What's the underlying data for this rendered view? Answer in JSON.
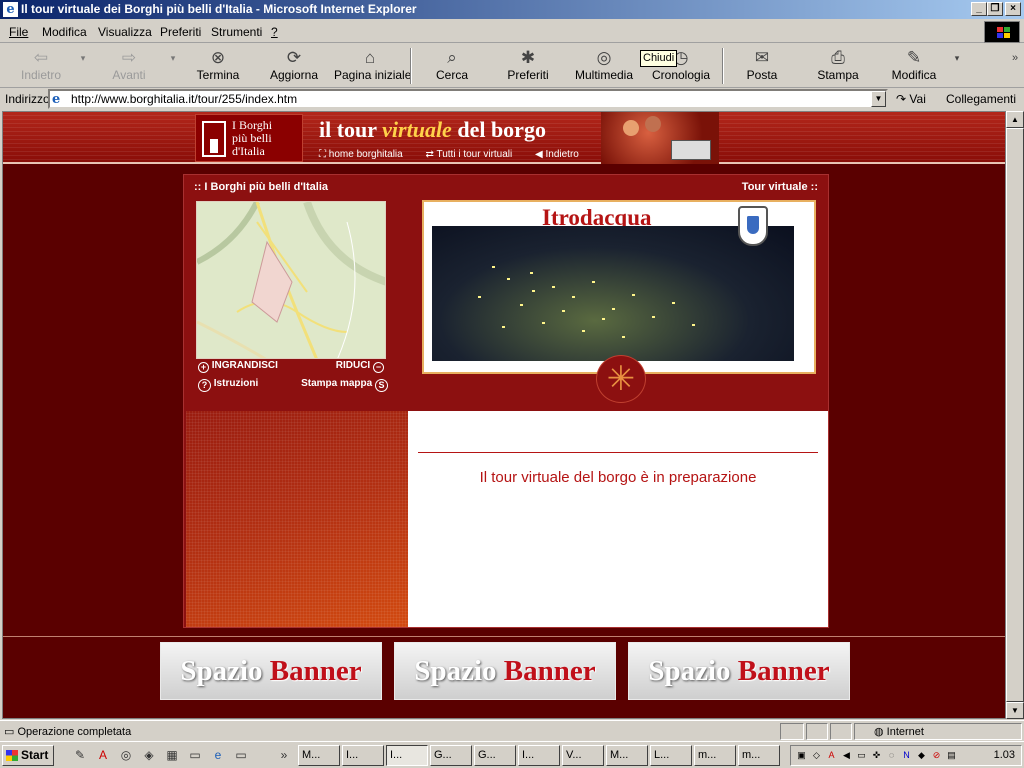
{
  "window": {
    "title": "Il tour virtuale dei Borghi più belli d'Italia - Microsoft Internet Explorer",
    "buttons": [
      "_",
      "❐",
      "×"
    ]
  },
  "menu": [
    "File",
    "Modifica",
    "Visualizza",
    "Preferiti",
    "Strumenti",
    "?"
  ],
  "toolbar": {
    "buttons": [
      {
        "label": "Indietro",
        "icon": "back-arrow-icon",
        "glyph": "⇦",
        "disabled": true
      },
      {
        "label": "Avanti",
        "icon": "forward-arrow-icon",
        "glyph": "⇨",
        "disabled": true
      },
      {
        "label": "Termina",
        "icon": "stop-icon",
        "glyph": "⊗",
        "disabled": false
      },
      {
        "label": "Aggiorna",
        "icon": "refresh-icon",
        "glyph": "⟳",
        "disabled": false
      },
      {
        "label": "Pagina iniziale",
        "icon": "home-icon",
        "glyph": "⌂",
        "disabled": false
      },
      {
        "label": "Cerca",
        "icon": "search-icon",
        "glyph": "⌕",
        "disabled": false
      },
      {
        "label": "Preferiti",
        "icon": "favorites-icon",
        "glyph": "✱",
        "disabled": false
      },
      {
        "label": "Multimedia",
        "icon": "media-icon",
        "glyph": "◎",
        "disabled": false
      },
      {
        "label": "Cronologia",
        "icon": "history-icon",
        "glyph": "◷",
        "disabled": false
      },
      {
        "label": "Posta",
        "icon": "mail-icon",
        "glyph": "✉",
        "disabled": false
      },
      {
        "label": "Stampa",
        "icon": "print-icon",
        "glyph": "⎙",
        "disabled": false
      },
      {
        "label": "Modifica",
        "icon": "edit-icon",
        "glyph": "✎",
        "disabled": false
      }
    ],
    "tooltip": "Chiudi"
  },
  "address": {
    "label": "Indirizzo",
    "url": "http://www.borghitalia.it/tour/255/index.htm",
    "go": "Vai",
    "links": "Collegamenti"
  },
  "site": {
    "logo_text": "I Borghi\npiù belli\nd'Italia",
    "title_pre": "il tour",
    "title_em": "virtuale",
    "title_post": "del borgo",
    "links": [
      "⛶ home borghitalia",
      "⇄ Tutti i tour virtuali",
      "◀ Indietro"
    ],
    "panel_left": ":: I Borghi più belli d'Italia",
    "panel_right": "Tour virtuale ::",
    "zoom_in": "INGRANDISCI",
    "zoom_out": "RIDUCI",
    "instructions": "Istruzioni",
    "print_map": "Stampa mappa",
    "town": "Itrodacqua",
    "message": "Il tour virtuale del borgo è in preparazione",
    "banner_a": "Spazio",
    "banner_b": "Banner"
  },
  "status": {
    "text": "Operazione completata",
    "zone": "Internet"
  },
  "taskbar": {
    "start": "Start",
    "tasks": [
      "M...",
      "I...",
      "I...",
      "G...",
      "G...",
      "I...",
      "V...",
      "M...",
      "L...",
      "m...",
      "m..."
    ],
    "clock": "1.03"
  },
  "colors": {
    "page_bg": "#5a0000",
    "panel": "#8c1010",
    "accent_red": "#b51414",
    "gold": "#ffd24a"
  }
}
